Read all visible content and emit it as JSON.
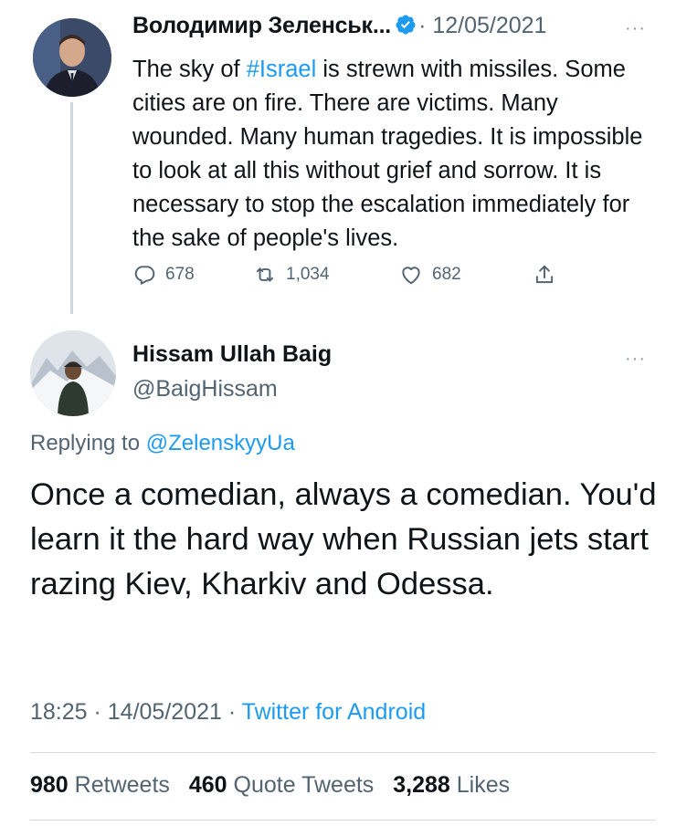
{
  "parent_tweet": {
    "author_name": "Володимир Зеленськ...",
    "verified_icon": "verified-badge-icon",
    "date": "· 12/05/2021",
    "more_label": "···",
    "text_before_hashtag": "The sky of ",
    "hashtag": "#Israel",
    "text_after_hashtag": " is strewn with missiles. Some cities are on fire. There are victims. Many wounded. Many human tragedies. It is impossible to look at all this without grief and sorrow. It is necessary to stop the escalation immediately for the sake of people's lives.",
    "actions": {
      "replies": "678",
      "retweets": "1,034",
      "likes": "682"
    }
  },
  "reply_tweet": {
    "author_name": "Hissam Ullah Baig",
    "handle": "@BaigHissam",
    "more_label": "···",
    "replying_prefix": "Replying to ",
    "replying_to": "@ZelenskyyUa",
    "text": "Once a comedian, always a comedian. You'd learn it the hard way when Russian jets start razing Kiev, Kharkiv and Odessa.",
    "time_date": "18:25 · 14/05/2021 · ",
    "source": "Twitter for Android",
    "stats": {
      "retweets_count": "980",
      "retweets_label": "Retweets",
      "quotes_count": "460",
      "quotes_label": "Quote Tweets",
      "likes_count": "3,288",
      "likes_label": "Likes"
    }
  },
  "colors": {
    "link_blue": "#1d9bf0",
    "secondary_text": "#536471",
    "divider": "#cfd9de"
  }
}
